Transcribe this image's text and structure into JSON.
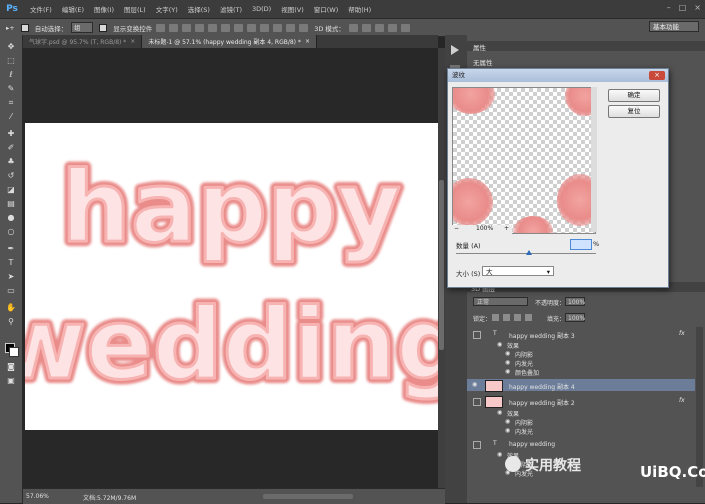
{
  "menubar": {
    "logo": "Ps",
    "items": [
      "文件(F)",
      "编辑(E)",
      "图像(I)",
      "图层(L)",
      "文字(Y)",
      "选择(S)",
      "滤镜(T)",
      "3D(D)",
      "视图(V)",
      "窗口(W)",
      "帮助(H)"
    ],
    "min": "–",
    "max": "□",
    "close": "×"
  },
  "options": {
    "auto_select": "自动选择：",
    "group": "组",
    "show_transform": "显示变换控件",
    "mode3d": "3D 模式：",
    "workspace": "基本功能"
  },
  "tabs": [
    {
      "label": "气球字.psd @ 95.7% (T, RGB/8) *",
      "close": "×"
    },
    {
      "label": "未标题-1 @ 57.1% (happy wedding 副本 4, RGB/8) *",
      "close": "×"
    }
  ],
  "document": {
    "line1": "happy",
    "line2": "wedding"
  },
  "status": {
    "zoom": "57.06%",
    "doc": "文档:5.72M/9.76M"
  },
  "properties_panel": {
    "tab": "属性",
    "title": "无属性"
  },
  "filter_dialog": {
    "title": "波纹",
    "ok": "确定",
    "reset": "复位",
    "zoom": "100%",
    "minus": "−",
    "plus": "+",
    "amount_label": "数量 (A)",
    "amount_unit": "%",
    "size_label": "大小 (S)",
    "size_value": "大"
  },
  "layers_panel": {
    "tab_partial": "3D  图层",
    "blend_mode": "正常",
    "opacity_label": "不透明度：",
    "opacity_value": "100%",
    "lock_label": "锁定：",
    "fill_label": "填充：",
    "fill_value": "100%",
    "fx": "fx",
    "rows": [
      {
        "name": "happy wedding 副本 3",
        "type": "T"
      },
      {
        "name": "效果",
        "type": "sub"
      },
      {
        "name": "内阴影",
        "type": "subsub"
      },
      {
        "name": "内发光",
        "type": "subsub"
      },
      {
        "name": "颜色叠加",
        "type": "subsub"
      },
      {
        "name": "happy wedding 副本 4",
        "type": "img"
      },
      {
        "name": "happy wedding 副本 2",
        "type": "img"
      },
      {
        "name": "效果",
        "type": "sub"
      },
      {
        "name": "内阴影",
        "type": "subsub"
      },
      {
        "name": "内发光",
        "type": "subsub"
      },
      {
        "name": "happy wedding",
        "type": "T"
      },
      {
        "name": "效果",
        "type": "sub"
      },
      {
        "name": "内阴影",
        "type": "subsub"
      },
      {
        "name": "内发光",
        "type": "subsub"
      }
    ]
  },
  "watermark": {
    "text": "实用教程",
    "site": "UiBQ.CoM"
  },
  "colors": {
    "text_pink": "#f3a3a1",
    "selected_layer": "#6b7d99",
    "ps_blue": "#5ab4ff"
  },
  "icons": [
    "move-tool-icon",
    "marquee-tool-icon",
    "lasso-tool-icon",
    "quick-select-icon",
    "crop-tool-icon",
    "eyedropper-icon",
    "healing-brush-icon",
    "brush-tool-icon",
    "stamp-tool-icon",
    "history-brush-icon",
    "eraser-icon",
    "gradient-tool-icon",
    "blur-tool-icon",
    "dodge-tool-icon",
    "pen-tool-icon",
    "type-tool-icon",
    "path-select-icon",
    "shape-tool-icon",
    "hand-tool-icon",
    "zoom-tool-icon",
    "eye-icon",
    "lock-icon",
    "wechat-icon"
  ]
}
